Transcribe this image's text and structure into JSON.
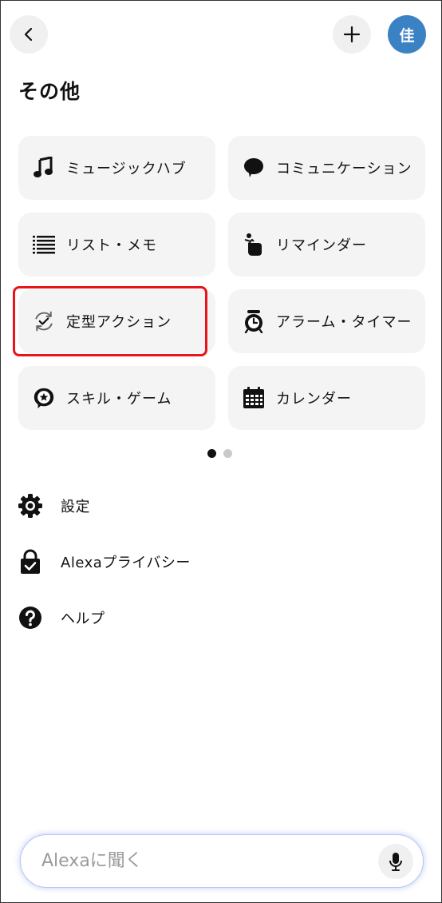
{
  "header": {
    "back_icon": "chevron-left-icon",
    "add_icon": "plus-icon",
    "avatar_text": "佳",
    "avatar_color": "#3b82c4",
    "title": "その他"
  },
  "tiles": [
    {
      "label": "ミュージックハブ",
      "icon": "music-note-icon"
    },
    {
      "label": "コミュニケーション",
      "icon": "speech-bubble-icon"
    },
    {
      "label": "リスト・メモ",
      "icon": "list-icon"
    },
    {
      "label": "リマインダー",
      "icon": "reminder-hand-icon"
    },
    {
      "label": "定型アクション",
      "icon": "routine-check-icon",
      "highlighted": true
    },
    {
      "label": "アラーム・タイマー",
      "icon": "alarm-clock-icon"
    },
    {
      "label": "スキル・ゲーム",
      "icon": "skills-star-icon"
    },
    {
      "label": "カレンダー",
      "icon": "calendar-icon"
    }
  ],
  "pager": {
    "total": 2,
    "active": 1
  },
  "menu": [
    {
      "label": "設定",
      "icon": "gear-icon"
    },
    {
      "label": "Alexaプライバシー",
      "icon": "privacy-lock-icon"
    },
    {
      "label": "ヘルプ",
      "icon": "help-icon"
    }
  ],
  "search": {
    "placeholder": "Alexaに聞く",
    "value": "",
    "mic_icon": "microphone-icon"
  },
  "colors": {
    "highlight": "#e8141b",
    "tile_bg": "#f4f4f4",
    "search_glow": "#b7c6f4"
  }
}
